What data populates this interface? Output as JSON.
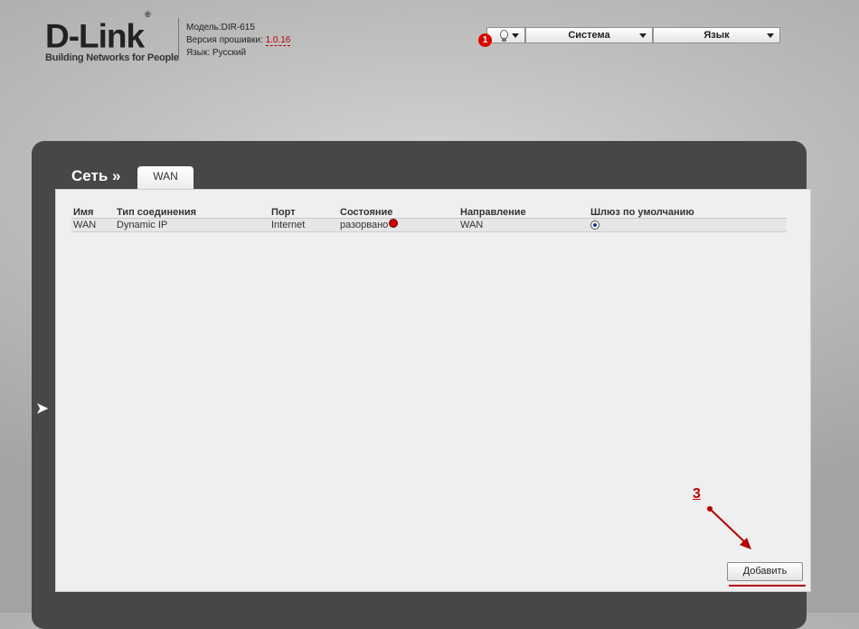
{
  "header": {
    "logo_text": "D-Link",
    "logo_mark": "®",
    "logo_tagline": "Building Networks for People",
    "model_label": "Модель:DIR-615",
    "firmware_label": "Версия прошивки:",
    "firmware_version": "1.0.16",
    "language_label": "Язык: Русский"
  },
  "topbar": {
    "notification_count": "1",
    "system_label": "Система",
    "language_label": "Язык"
  },
  "page": {
    "breadcrumb": "Сеть »",
    "tab_label": "WAN"
  },
  "table": {
    "headers": {
      "name": "Имя",
      "type": "Тип соединения",
      "port": "Порт",
      "state": "Состояние",
      "direction": "Направление",
      "gateway": "Шлюз по умолчанию"
    },
    "rows": [
      {
        "name": "WAN",
        "type": "Dynamic IP",
        "port": "Internet",
        "state": "разорвано",
        "direction": "WAN",
        "default_gateway": true
      }
    ]
  },
  "actions": {
    "add_label": "Добавить"
  },
  "annotation": {
    "step_number": "3"
  },
  "colors": {
    "accent_red": "#b50000",
    "panel": "#474747",
    "content_bg": "#efefef"
  }
}
